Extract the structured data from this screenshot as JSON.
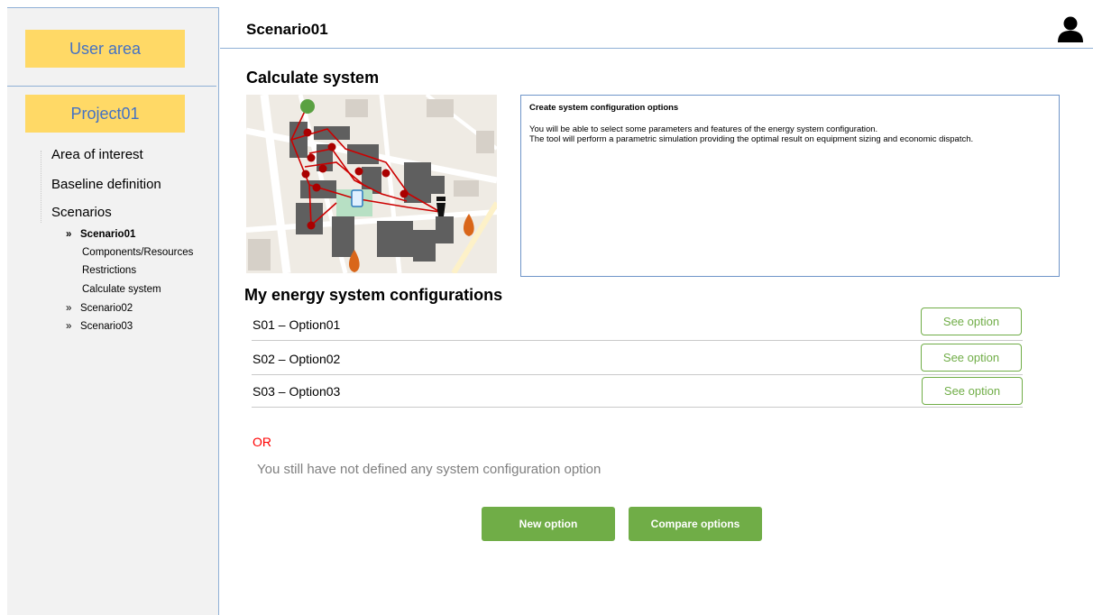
{
  "sidebar": {
    "user_area_label": "User area",
    "project_label": "Project01",
    "nav": [
      {
        "label": "Area of interest"
      },
      {
        "label": "Baseline definition"
      },
      {
        "label": "Scenarios"
      }
    ],
    "scenarios": [
      {
        "chevron": "»",
        "label": "Scenario01",
        "children": [
          "Components/Resources",
          "Restrictions",
          "Calculate system"
        ]
      },
      {
        "chevron": "»",
        "label": "Scenario02"
      },
      {
        "chevron": "»",
        "label": "Scenario03"
      }
    ]
  },
  "header": {
    "title": "Scenario01",
    "avatar_icon": "user-icon"
  },
  "main": {
    "calculate_title": "Calculate system",
    "map_icons": [
      "tree-icon",
      "phone-icon",
      "chimney-icon",
      "flame-icon",
      "flame-icon"
    ],
    "info": {
      "title": "Create system configuration options",
      "line1": "You will be able to select some parameters and features of the energy system configuration.",
      "line2": "The tool will perform a parametric simulation providing the optimal result on equipment sizing and economic dispatch."
    },
    "configs_title": "My energy system configurations",
    "options": [
      {
        "label": "S01 – Option01",
        "button": "See option"
      },
      {
        "label": "S02 – Option02",
        "button": "See option"
      },
      {
        "label": "S03 – Option03",
        "button": "See option"
      }
    ],
    "or_label": "OR",
    "empty_message": "You still have not defined any system configuration option",
    "new_option_label": "New option",
    "compare_options_label": "Compare options"
  },
  "colors": {
    "accent_yellow": "#ffd966",
    "link_blue": "#4472c4",
    "green": "#70ad47",
    "or_red": "#ff0000",
    "border_blue": "#8fb0d6"
  }
}
